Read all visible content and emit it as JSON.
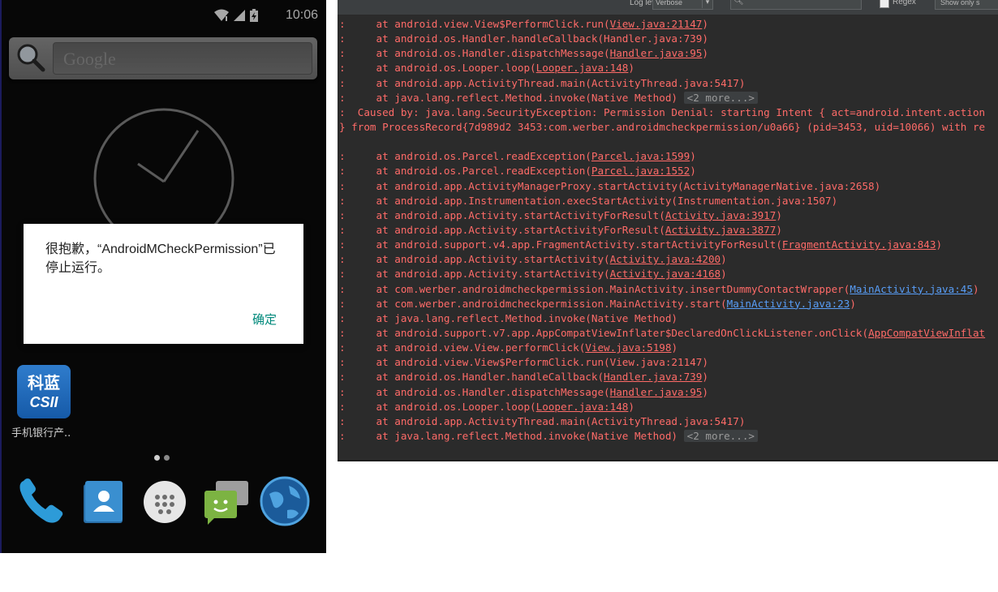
{
  "status_bar": {
    "time": "10:06"
  },
  "search_bar": {
    "placeholder": "Google"
  },
  "dialog": {
    "message": "很抱歉，“AndroidMCheckPermission”已停止运行。",
    "ok_label": "确定"
  },
  "home": {
    "app_shortcut": {
      "icon_text_top": "科蓝",
      "icon_text_bottom": "CSII",
      "label": "手机银行产.."
    },
    "dock": [
      "phone-icon",
      "contacts-icon",
      "app-drawer-icon",
      "messaging-icon",
      "browser-icon"
    ]
  },
  "logcat": {
    "toolbar": {
      "log_level_label": "Log level:",
      "log_level_value": "Verbose",
      "regex_label": "Regex",
      "show_only_label": "Show only s"
    },
    "lines": [
      {
        "pre": ":     at android.view.View$PerformClick.run(",
        "link": "View.java:21147",
        "post": ")"
      },
      {
        "pre": ":     at android.os.Handler.handleCallback(Handler.java:739)",
        "link": "",
        "post": ""
      },
      {
        "pre": ":     at android.os.Handler.dispatchMessage(",
        "link": "Handler.java:95",
        "post": ")"
      },
      {
        "pre": ":     at android.os.Looper.loop(",
        "link": "Looper.java:148",
        "post": ")"
      },
      {
        "pre": ":     at android.app.ActivityThread.main(ActivityThread.java:5417)",
        "link": "",
        "post": ""
      },
      {
        "pre": ":     at java.lang.reflect.Method.invoke(Native Method) ",
        "link": "",
        "post": "",
        "more": "<2 more...>"
      },
      {
        "pre": ":  Caused by: java.lang.SecurityException: Permission Denial: starting Intent { act=android.intent.action",
        "link": "",
        "post": ""
      },
      {
        "pre": "} from ProcessRecord{7d989d2 3453:com.werber.androidmcheckpermission/u0a66} (pid=3453, uid=10066) with re",
        "link": "",
        "post": ""
      },
      {
        "pre": "",
        "link": "",
        "post": ""
      },
      {
        "pre": ":     at android.os.Parcel.readException(",
        "link": "Parcel.java:1599",
        "post": ")"
      },
      {
        "pre": ":     at android.os.Parcel.readException(",
        "link": "Parcel.java:1552",
        "post": ")"
      },
      {
        "pre": ":     at android.app.ActivityManagerProxy.startActivity(ActivityManagerNative.java:2658)",
        "link": "",
        "post": ""
      },
      {
        "pre": ":     at android.app.Instrumentation.execStartActivity(Instrumentation.java:1507)",
        "link": "",
        "post": ""
      },
      {
        "pre": ":     at android.app.Activity.startActivityForResult(",
        "link": "Activity.java:3917",
        "post": ")"
      },
      {
        "pre": ":     at android.app.Activity.startActivityForResult(",
        "link": "Activity.java:3877",
        "post": ")"
      },
      {
        "pre": ":     at android.support.v4.app.FragmentActivity.startActivityForResult(",
        "link": "FragmentActivity.java:843",
        "post": ")"
      },
      {
        "pre": ":     at android.app.Activity.startActivity(",
        "link": "Activity.java:4200",
        "post": ")"
      },
      {
        "pre": ":     at android.app.Activity.startActivity(",
        "link": "Activity.java:4168",
        "post": ")"
      },
      {
        "pre": ":     at com.werber.androidmcheckpermission.MainActivity.insertDummyContactWrapper(",
        "link": "MainActivity.java:45",
        "post": ")",
        "blue": true
      },
      {
        "pre": ":     at com.werber.androidmcheckpermission.MainActivity.start(",
        "link": "MainActivity.java:23",
        "post": ")",
        "blue": true
      },
      {
        "pre": ":     at java.lang.reflect.Method.invoke(Native Method)",
        "link": "",
        "post": ""
      },
      {
        "pre": ":     at android.support.v7.app.AppCompatViewInflater$DeclaredOnClickListener.onClick(",
        "link": "AppCompatViewInflat",
        "post": ""
      },
      {
        "pre": ":     at android.view.View.performClick(",
        "link": "View.java:5198",
        "post": ")"
      },
      {
        "pre": ":     at android.view.View$PerformClick.run(View.java:21147)",
        "link": "",
        "post": ""
      },
      {
        "pre": ":     at android.os.Handler.handleCallback(",
        "link": "Handler.java:739",
        "post": ")"
      },
      {
        "pre": ":     at android.os.Handler.dispatchMessage(",
        "link": "Handler.java:95",
        "post": ")"
      },
      {
        "pre": ":     at android.os.Looper.loop(",
        "link": "Looper.java:148",
        "post": ")"
      },
      {
        "pre": ":     at android.app.ActivityThread.main(ActivityThread.java:5417)",
        "link": "",
        "post": ""
      },
      {
        "pre": ":     at java.lang.reflect.Method.invoke(Native Method) ",
        "link": "",
        "post": "",
        "more": "<2 more...>"
      }
    ]
  }
}
